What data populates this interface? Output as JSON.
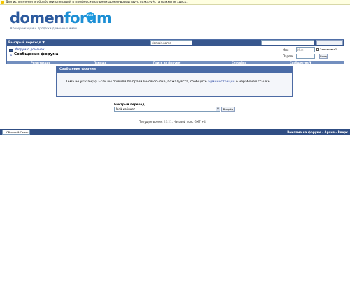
{
  "notice": {
    "text": "Для исполнения и обработки операций в профессиональном домен-ворлдтаун, пожалуйста нажмите здесь."
  },
  "logo": {
    "part1": "domen",
    "part2": "forum",
    "badge": "net",
    "tagline": "Коммуникации и продажи доменных имён"
  },
  "header": {
    "quick_nav": "Быстрый переход ▼",
    "search_value": "domain.name"
  },
  "breadcrumb": {
    "forum_link": "Форум о доменах",
    "arrow": "↳",
    "title": "Сообщение форума"
  },
  "login": {
    "name_label": "Имя",
    "name_placeholder": "Имя",
    "pass_label": "Пароль",
    "remember": "Запомнить?",
    "submit": "Вход"
  },
  "nav": {
    "items": [
      "Регистрация",
      "Помощь",
      "Поиск на форуме",
      "Случайно",
      "Сообщества ▼"
    ]
  },
  "message": {
    "header": "Сообщение форума",
    "body_pre": "Тема не указан(а). Если вы пришли по правильной ссылке, пожалуйста, сообщите ",
    "body_link": "администрации",
    "body_post": " о нерабочей ссылке."
  },
  "quick_navigation": {
    "label": "Быстрый переход",
    "selected": "Мой кабинет",
    "go": "Вперёд"
  },
  "time": {
    "prefix": "Текущее время: ",
    "value": "21:21",
    "suffix": ". Часовой пояс GMT +4."
  },
  "footer": {
    "style_select": "-- Обычный Стиль",
    "links": "Реклама на форуме - Архив - Вверх"
  }
}
